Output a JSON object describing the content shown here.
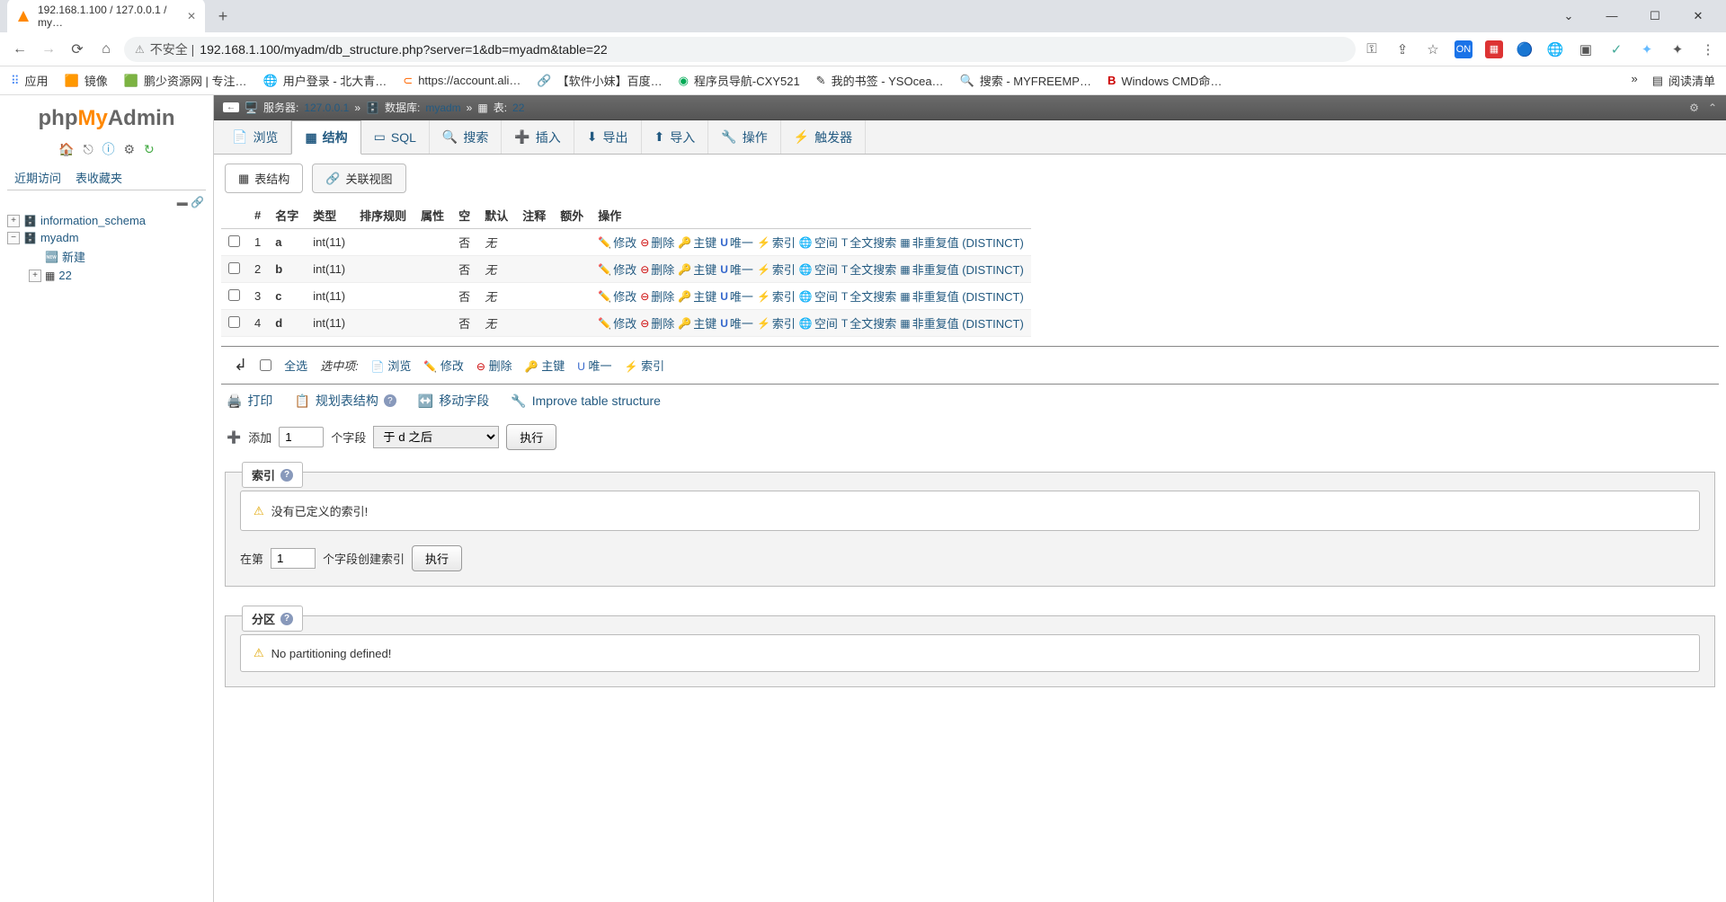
{
  "browser": {
    "tab_title": "192.168.1.100 / 127.0.0.1 / my…",
    "url_insecure": "不安全 |",
    "url": "192.168.1.100/myadm/db_structure.php?server=1&db=myadm&table=22",
    "bookmarks": [
      "应用",
      "镜像",
      "鹏少资源网 | 专注…",
      "用户登录 - 北大青…",
      "https://account.ali…",
      "【软件小妹】百度…",
      "程序员导航-CXY521",
      "我的书签 - YSOcea…",
      "搜索 - MYFREEMP…",
      "Windows CMD命…"
    ],
    "reading_list": "阅读清单"
  },
  "logo": {
    "php": "php",
    "my": "My",
    "admin": "Admin"
  },
  "sidebar": {
    "tab_recent": "近期访问",
    "tab_fav": "表收藏夹",
    "nodes": {
      "info_schema": "information_schema",
      "myadm": "myadm",
      "new": "新建",
      "tbl": "22"
    }
  },
  "breadcrumb": {
    "server_label": "服务器:",
    "server": "127.0.0.1",
    "db_label": "数据库:",
    "db": "myadm",
    "table_label": "表:",
    "table": "22"
  },
  "tabs": {
    "browse": "浏览",
    "structure": "结构",
    "sql": "SQL",
    "search": "搜索",
    "insert": "插入",
    "export": "导出",
    "import": "导入",
    "operations": "操作",
    "triggers": "触发器"
  },
  "subtabs": {
    "table_structure": "表结构",
    "relation_view": "关联视图"
  },
  "table": {
    "headers": {
      "num": "#",
      "name": "名字",
      "type": "类型",
      "collation": "排序规则",
      "attr": "属性",
      "null": "空",
      "default": "默认",
      "comment": "注释",
      "extra": "额外",
      "ops": "操作"
    },
    "rows": [
      {
        "num": "1",
        "name": "a",
        "type": "int(11)",
        "null": "否",
        "default": "无"
      },
      {
        "num": "2",
        "name": "b",
        "type": "int(11)",
        "null": "否",
        "default": "无"
      },
      {
        "num": "3",
        "name": "c",
        "type": "int(11)",
        "null": "否",
        "default": "无"
      },
      {
        "num": "4",
        "name": "d",
        "type": "int(11)",
        "null": "否",
        "default": "无"
      }
    ],
    "actions": {
      "change": "修改",
      "drop": "删除",
      "primary": "主键",
      "unique": "唯一",
      "index": "索引",
      "spatial": "空间",
      "fulltext": "全文搜索",
      "distinct": "非重复值 (DISTINCT)"
    }
  },
  "bulk": {
    "check_all": "全选",
    "with_selected": "选中项:",
    "browse": "浏览",
    "change": "修改",
    "drop": "删除",
    "primary": "主键",
    "unique": "唯一",
    "index": "索引"
  },
  "tools": {
    "print": "打印",
    "propose": "规划表结构",
    "move": "移动字段",
    "improve": "Improve table structure"
  },
  "add": {
    "label": "添加",
    "value": "1",
    "fields": "个字段",
    "after": "于 d 之后",
    "exec": "执行"
  },
  "indexes": {
    "title": "索引",
    "none": "没有已定义的索引!",
    "create_pre": "在第",
    "create_val": "1",
    "create_post": "个字段创建索引",
    "exec": "执行"
  },
  "partition": {
    "title": "分区",
    "none": "No partitioning defined!"
  }
}
